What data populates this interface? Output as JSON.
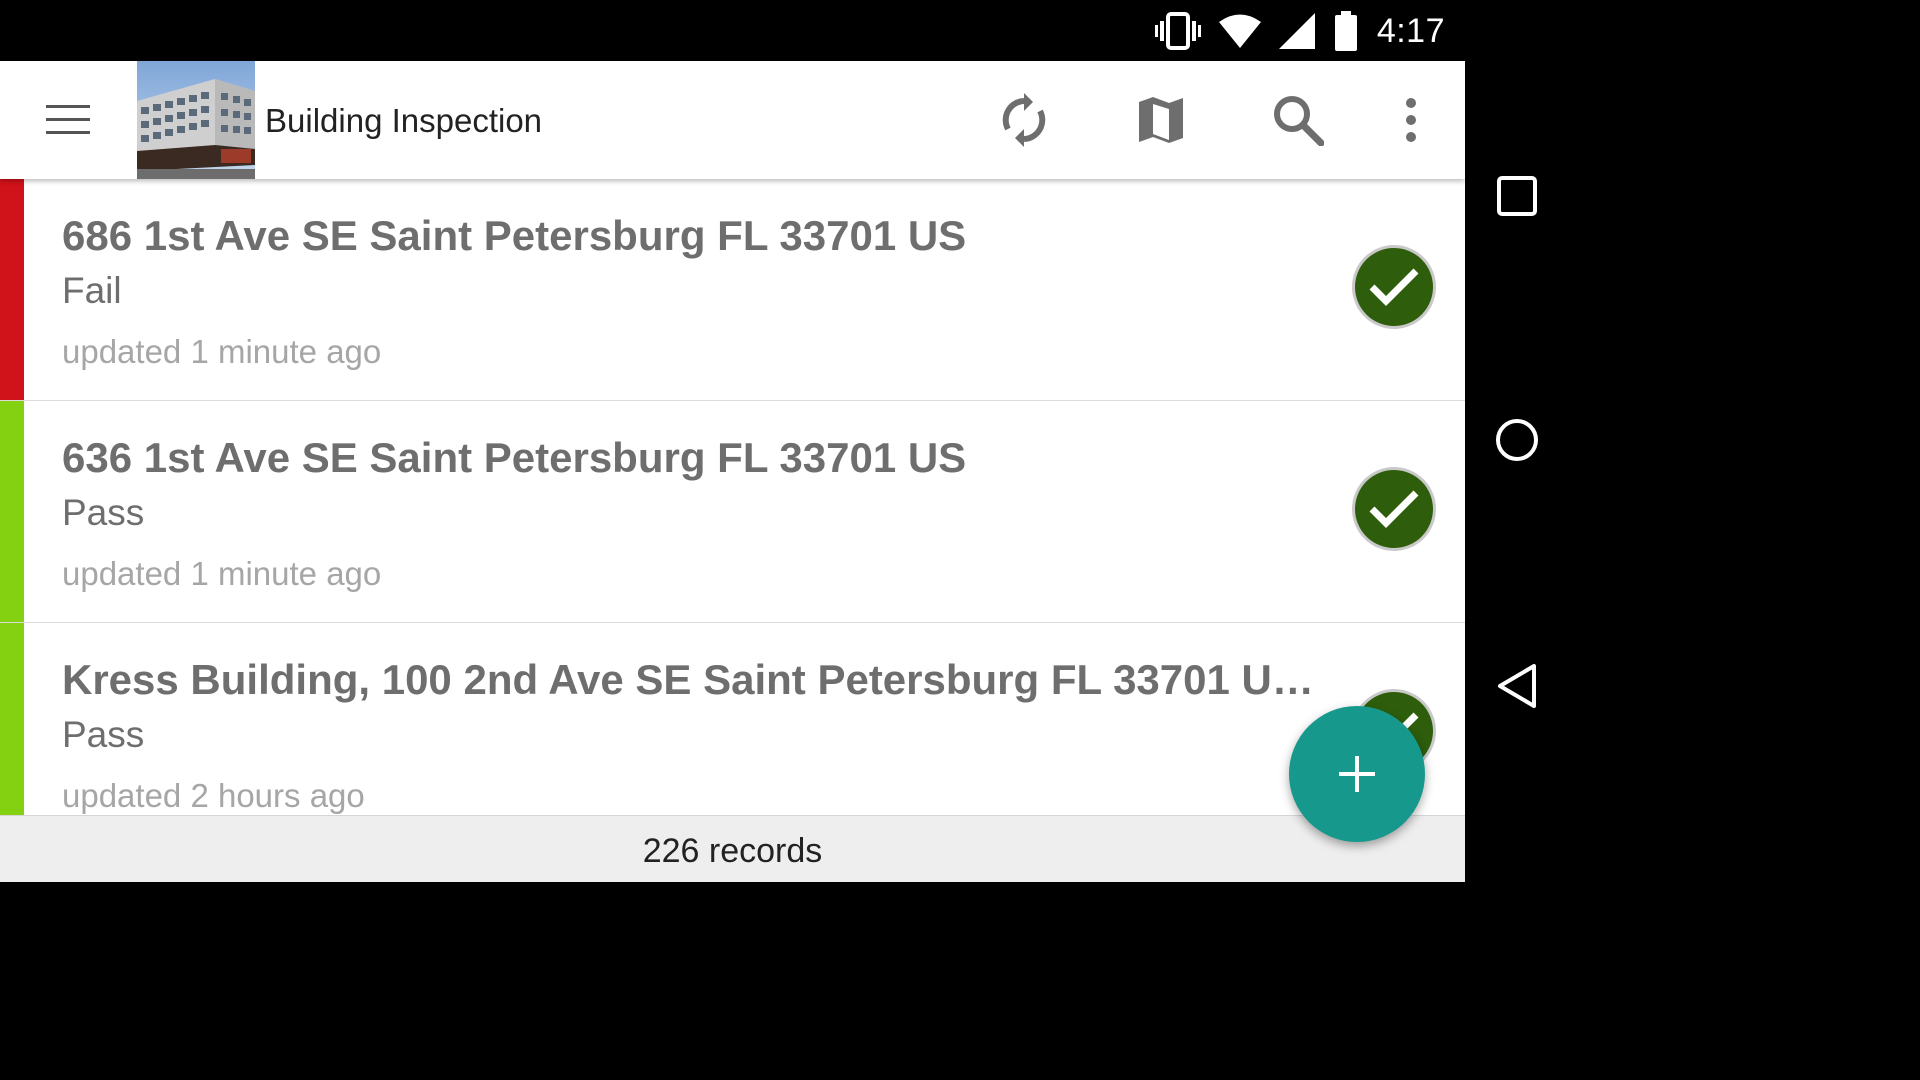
{
  "status_bar": {
    "time": "4:17",
    "icons": [
      "vibrate-icon",
      "wifi-icon",
      "cell-signal-icon",
      "battery-icon"
    ]
  },
  "toolbar": {
    "title": "Building Inspection",
    "actions": [
      "sync-icon",
      "map-icon",
      "search-icon",
      "more-vert-icon"
    ]
  },
  "records": [
    {
      "title": "686 1st Ave SE Saint Petersburg FL 33701 US",
      "status": "Fail",
      "updated": "updated 1 minute ago",
      "stripe_color": "#d0121a"
    },
    {
      "title": "636 1st Ave SE Saint Petersburg FL 33701 US",
      "status": "Pass",
      "updated": "updated 1 minute ago",
      "stripe_color": "#84d111"
    },
    {
      "title": "Kress Building, 100 2nd Ave SE Saint Petersburg FL 33701 US...",
      "status": "Pass",
      "updated": "updated 2 hours ago",
      "stripe_color": "#84d111"
    }
  ],
  "footer": {
    "record_count": "226 records"
  },
  "colors": {
    "accent": "#16998c",
    "check_badge": "#2e5e0c",
    "fail": "#d0121a",
    "pass": "#84d111"
  }
}
